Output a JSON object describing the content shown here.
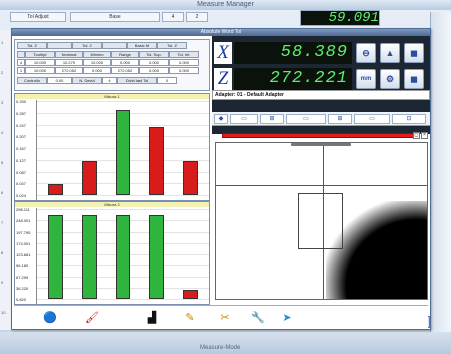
{
  "background": {
    "title": "Measure Manager",
    "toolbar_labels": [
      "Tol Adjust",
      "Base",
      "4",
      "2"
    ],
    "bottom_caption": "Measure-Mode",
    "left_numbers": [
      "1",
      "2",
      "3",
      "4",
      "5",
      "6",
      "7",
      "8",
      "9",
      "10"
    ],
    "top_digits": "59.091"
  },
  "main": {
    "title": "Absolute Word Tol",
    "dro": {
      "x_label": "X",
      "x_value": "58.389",
      "z_label": "Z",
      "z_value": "272.221",
      "unit_label": "mm",
      "colors": {
        "digits": "#5cf06b",
        "bg": "#0b110b",
        "axis": "#1a3d9c"
      }
    },
    "adapter_text": "Adapter: 01 - Default Adapter",
    "table": {
      "header_row": [
        "Tol. Z",
        "",
        "Tol. 2",
        "",
        "Basic M",
        "Tol. Z"
      ],
      "header2": [
        "Toolhpt",
        "Nominal",
        "Minimo",
        "Range",
        "Tol. Sup.",
        "Tol. Inf."
      ],
      "row1": [
        "4",
        "10.000",
        "10.279",
        "10.000",
        "0.000",
        "0.000",
        "0.000"
      ],
      "row2": [
        "1",
        "10.000",
        "272.052",
        "0.000",
        "272.052",
        "0.000",
        "0.000"
      ],
      "footer": [
        "Controllo",
        "0.00",
        "N. Devid",
        "4",
        "Divid last Tol",
        "0"
      ]
    },
    "chart_data": [
      {
        "type": "bar",
        "title": "Misura 1",
        "y_ticks": [
          "0.330",
          "0.287",
          "0.247",
          "0.207",
          "0.167",
          "0.127",
          "0.087",
          "0.047",
          "0.024"
        ],
        "categories": [
          "1",
          "2",
          "3",
          "4",
          "5"
        ],
        "values": [
          0.04,
          0.12,
          0.3,
          0.24,
          0.12
        ],
        "colors": [
          "#d81c1c",
          "#d81c1c",
          "#2fb43d",
          "#d81c1c",
          "#d81c1c"
        ]
      },
      {
        "type": "bar",
        "title": "Misura 2",
        "y_ticks": [
          "298.111",
          "248.001",
          "197.795",
          "174.001",
          "123.681",
          "96.180",
          "67.299",
          "36.220",
          "0.820"
        ],
        "categories": [
          "1",
          "2",
          "3",
          "4",
          "5"
        ],
        "values": [
          280,
          280,
          280,
          280,
          30
        ],
        "colors": [
          "#2fb43d",
          "#2fb43d",
          "#2fb43d",
          "#2fb43d",
          "#d81c1c"
        ]
      }
    ],
    "camera_buttons": [
      "◆",
      "▭",
      "⊞",
      "▭",
      "⊞",
      "▭",
      "⊡"
    ],
    "bottom_icons": [
      "info-icon",
      "paint-icon",
      "chart-icon",
      "pen-icon",
      "tools-icon",
      "wrench-icon",
      "arrow-icon"
    ],
    "bottom_glyphs": [
      "🔵",
      "🖌",
      "▟",
      "✎",
      "✂",
      "🔧",
      "➤"
    ]
  }
}
